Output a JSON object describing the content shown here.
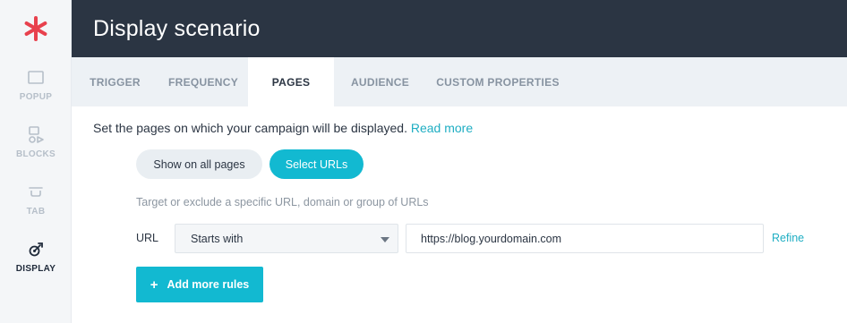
{
  "app": {
    "accent_color": "#12b9d1",
    "brand_color": "#e8414d",
    "header_bg": "#2b3543"
  },
  "sidebar": {
    "logo_icon": "asterisk-logo-icon",
    "items": [
      {
        "label": "POPUP",
        "icon": "popup-square-icon",
        "active": false
      },
      {
        "label": "BLOCKS",
        "icon": "blocks-shapes-icon",
        "active": false
      },
      {
        "label": "TAB",
        "icon": "tab-icon",
        "active": false
      },
      {
        "label": "DISPLAY",
        "icon": "display-target-icon",
        "active": true
      }
    ]
  },
  "header": {
    "title": "Display scenario"
  },
  "tabs": [
    {
      "label": "TRIGGER",
      "active": false
    },
    {
      "label": "FREQUENCY",
      "active": false
    },
    {
      "label": "PAGES",
      "active": true
    },
    {
      "label": "AUDIENCE",
      "active": false
    },
    {
      "label": "CUSTOM PROPERTIES",
      "active": false
    }
  ],
  "pages": {
    "intro_text": "Set the pages on which your campaign will be displayed.",
    "read_more": "Read more",
    "toggle": {
      "show_all": "Show on all pages",
      "select_urls": "Select URLs",
      "selected": "select_urls"
    },
    "helper_text": "Target or exclude a specific URL, domain or group of URLs",
    "rule": {
      "label": "URL",
      "operator": "Starts with",
      "value": "https://blog.yourdomain.com",
      "refine": "Refine"
    },
    "add_rules": "Add more rules"
  }
}
